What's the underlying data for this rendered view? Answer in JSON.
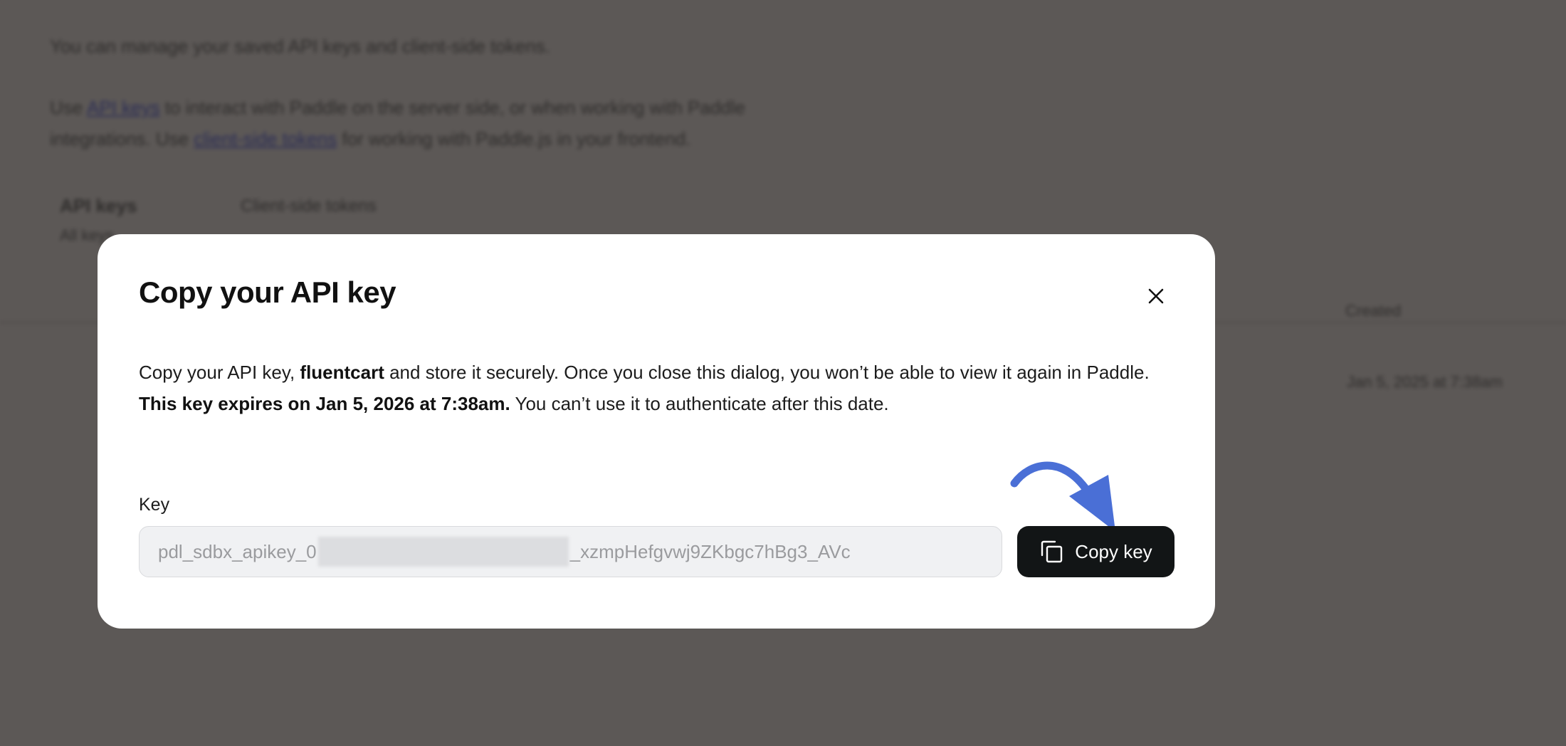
{
  "background": {
    "line1": "You can manage your saved API keys and client-side tokens.",
    "line2_before": "Use",
    "line2_link": "API keys",
    "line2_after": "to interact with Paddle on the server side, or when working with Paddle",
    "line3_before": "integrations. Use",
    "line3_link": "client-side tokens",
    "line3_after": "for working with Paddle.js in your frontend.",
    "tab_active": "API keys",
    "tab_active_sub": "All keys",
    "tab_other": "Client-side tokens",
    "col_header_right": "Created",
    "row_value_right": "Jan 5, 2025 at 7:38am"
  },
  "modal": {
    "title": "Copy your API key",
    "body_part1": "Copy your API key, ",
    "body_key_name": "fluentcart",
    "body_part2": " and store it securely. Once you close this dialog, you won’t be able to view it again in Paddle. ",
    "body_bold": "This key expires on Jan 5, 2026 at 7:38am.",
    "body_part3": " You can’t use it to authenticate after this date.",
    "key_label": "Key",
    "key_prefix": "pdl_sdbx_apikey_0",
    "key_suffix": "_xzmpHefgvwj9ZKbgc7hBg3_AVc",
    "copy_button_label": "Copy key",
    "close_icon": "close-icon",
    "copy_icon": "copy-icon"
  },
  "colors": {
    "overlay": "#5c5856",
    "button_bg": "#121516",
    "arrow": "#4a6fd6"
  }
}
